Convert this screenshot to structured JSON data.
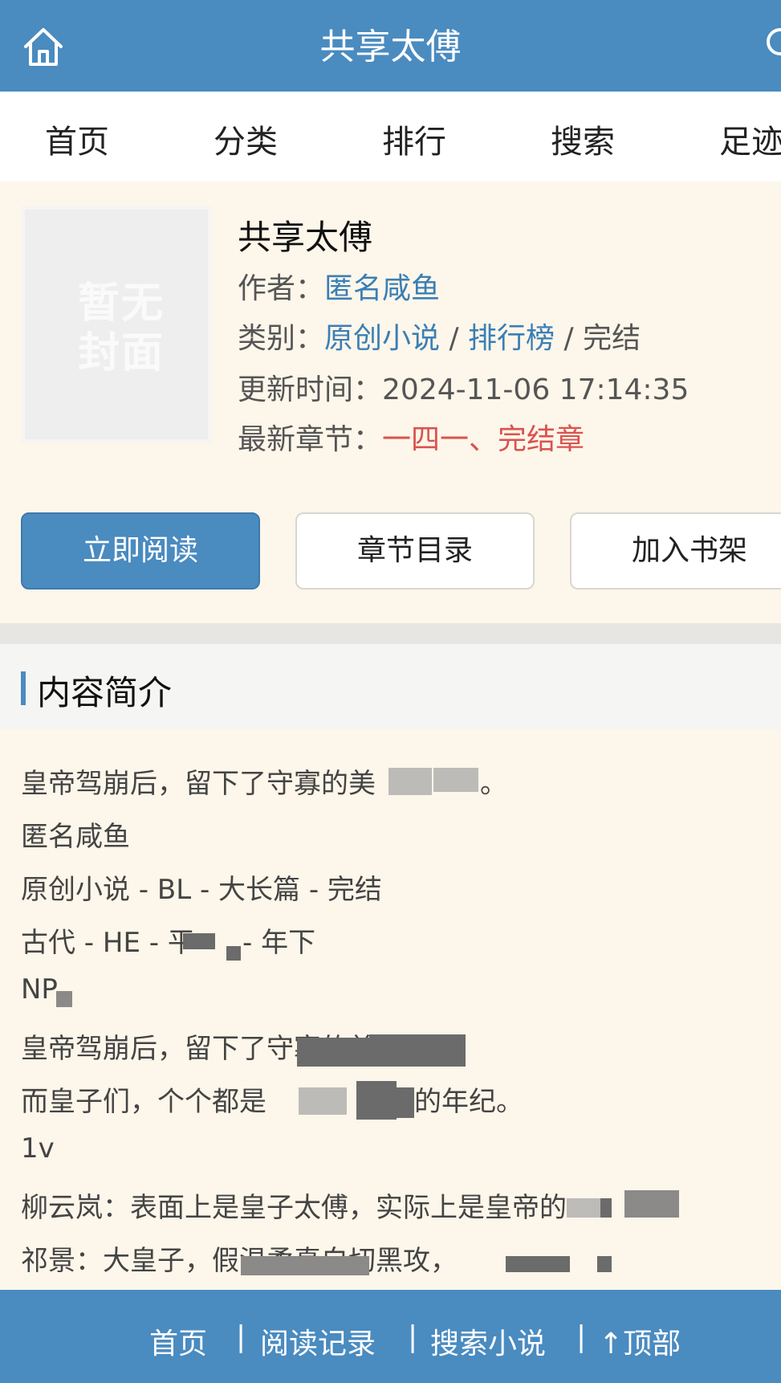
{
  "header": {
    "title": "共享太傅",
    "home_icon": "home-icon",
    "search_icon": "search-icon"
  },
  "nav": [
    "首页",
    "分类",
    "排行",
    "搜索",
    "足迹"
  ],
  "book": {
    "cover_placeholder": "暂无封面",
    "title": "共享太傅",
    "author_label": "作者：",
    "author": "匿名咸鱼",
    "category_label": "类别：",
    "category": "原创小说",
    "sep1": " / ",
    "ranking": "排行榜",
    "sep2": " / 完结",
    "updated_label": "更新时间：",
    "updated": "2024-11-06 17:14:35",
    "latest_label": "最新章节：",
    "latest": "一四一、完结章"
  },
  "buttons": {
    "read": "立即阅读",
    "toc": "章节目录",
    "shelf": "加入书架"
  },
  "intro": {
    "heading": "内容简介",
    "lines": [
      "皇帝驾崩后，留下了守寡的美",
      "匿名咸鱼",
      "原创小说 - BL - 大长篇 - 完结",
      "古代 - HE - 平",
      "NP",
      "皇帝驾崩后，留下了守寡的美",
      "而皇子们，个个都是",
      "1v",
      "柳云岚：表面上是皇子太傅，实际上是皇帝的",
      "祁景：大皇子，假温柔真白切黑攻，"
    ],
    "tail1": "。",
    "tail3": "- 年下",
    "tail6": "的年纪。"
  },
  "footer": {
    "home": "首页",
    "history": "阅读记录",
    "search": "搜索小说",
    "top": "↑顶部",
    "sep": "|"
  },
  "colors": {
    "accent": "#4a8bc0",
    "background": "#fdf6ea",
    "link": "#3a7fb5",
    "latest": "#d9534f"
  }
}
